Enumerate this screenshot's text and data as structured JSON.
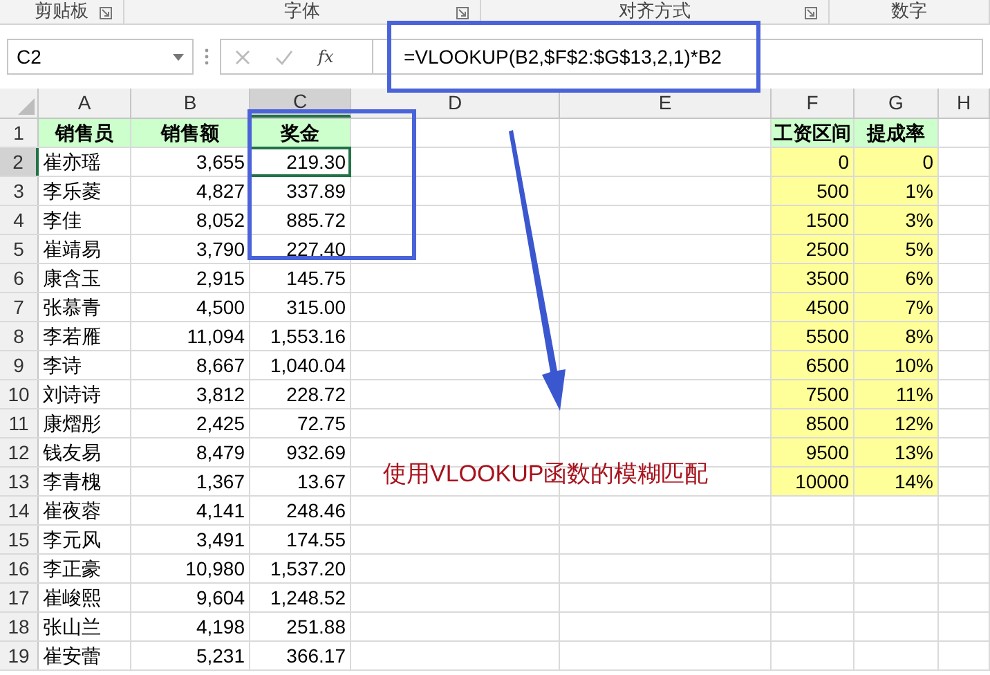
{
  "ribbon_groups": [
    {
      "label": "剪贴板",
      "launcher": true
    },
    {
      "label": "字体",
      "launcher": true
    },
    {
      "label": "对齐方式",
      "launcher": true
    },
    {
      "label": "数字"
    }
  ],
  "formula_bar": {
    "name_box": "C2",
    "fx": "fx",
    "formula": "=VLOOKUP(B2,$F$2:$G$13,2,1)*B2"
  },
  "columns": [
    {
      "label": "A",
      "selected": false
    },
    {
      "label": "B",
      "selected": false
    },
    {
      "label": "C",
      "selected": true
    },
    {
      "label": "D",
      "selected": false
    },
    {
      "label": "E",
      "selected": false
    },
    {
      "label": "F",
      "selected": false
    },
    {
      "label": "G",
      "selected": false
    },
    {
      "label": "H",
      "selected": false
    }
  ],
  "rows": [
    {
      "number": "1",
      "kind": "header",
      "selected": false,
      "salesperson": "销售员",
      "sales": "销售额",
      "bonus": "奖金",
      "bracket": "工资区间",
      "rate": "提成率"
    },
    {
      "number": "2",
      "kind": "data",
      "selected": true,
      "salesperson": "崔亦瑶",
      "sales": "3,655",
      "bonus": "219.30",
      "bracket": "0",
      "rate": "0"
    },
    {
      "number": "3",
      "kind": "data",
      "selected": false,
      "salesperson": "李乐菱",
      "sales": "4,827",
      "bonus": "337.89",
      "bracket": "500",
      "rate": "1%"
    },
    {
      "number": "4",
      "kind": "data",
      "selected": false,
      "salesperson": "李佳",
      "sales": "8,052",
      "bonus": "885.72",
      "bracket": "1500",
      "rate": "3%"
    },
    {
      "number": "5",
      "kind": "data",
      "selected": false,
      "salesperson": "崔靖易",
      "sales": "3,790",
      "bonus": "227.40",
      "bracket": "2500",
      "rate": "5%"
    },
    {
      "number": "6",
      "kind": "data",
      "selected": false,
      "salesperson": "康含玉",
      "sales": "2,915",
      "bonus": "145.75",
      "bracket": "3500",
      "rate": "6%"
    },
    {
      "number": "7",
      "kind": "data",
      "selected": false,
      "salesperson": "张慕青",
      "sales": "4,500",
      "bonus": "315.00",
      "bracket": "4500",
      "rate": "7%"
    },
    {
      "number": "8",
      "kind": "data",
      "selected": false,
      "salesperson": "李若雁",
      "sales": "11,094",
      "bonus": "1,553.16",
      "bracket": "5500",
      "rate": "8%"
    },
    {
      "number": "9",
      "kind": "data",
      "selected": false,
      "salesperson": "李诗",
      "sales": "8,667",
      "bonus": "1,040.04",
      "bracket": "6500",
      "rate": "10%"
    },
    {
      "number": "10",
      "kind": "data",
      "selected": false,
      "salesperson": "刘诗诗",
      "sales": "3,812",
      "bonus": "228.72",
      "bracket": "7500",
      "rate": "11%"
    },
    {
      "number": "11",
      "kind": "data",
      "selected": false,
      "salesperson": "康熠彤",
      "sales": "2,425",
      "bonus": "72.75",
      "bracket": "8500",
      "rate": "12%"
    },
    {
      "number": "12",
      "kind": "data",
      "selected": false,
      "salesperson": "钱友易",
      "sales": "8,479",
      "bonus": "932.69",
      "bracket": "9500",
      "rate": "13%"
    },
    {
      "number": "13",
      "kind": "data",
      "selected": false,
      "salesperson": "李青槐",
      "sales": "1,367",
      "bonus": "13.67",
      "bracket": "10000",
      "rate": "14%"
    },
    {
      "number": "14",
      "kind": "data",
      "selected": false,
      "salesperson": "崔夜蓉",
      "sales": "4,141",
      "bonus": "248.46"
    },
    {
      "number": "15",
      "kind": "data",
      "selected": false,
      "salesperson": "李元风",
      "sales": "3,491",
      "bonus": "174.55"
    },
    {
      "number": "16",
      "kind": "data",
      "selected": false,
      "salesperson": "李正豪",
      "sales": "10,980",
      "bonus": "1,537.20"
    },
    {
      "number": "17",
      "kind": "data",
      "selected": false,
      "salesperson": "崔峻熙",
      "sales": "9,604",
      "bonus": "1,248.52"
    },
    {
      "number": "18",
      "kind": "data",
      "selected": false,
      "salesperson": "张山兰",
      "sales": "4,198",
      "bonus": "251.88"
    },
    {
      "number": "19",
      "kind": "data",
      "selected": false,
      "salesperson": "崔安蕾",
      "sales": "5,231",
      "bonus": "366.17"
    }
  ],
  "annotation": {
    "note": "使用VLOOKUP函数的模糊匹配"
  }
}
